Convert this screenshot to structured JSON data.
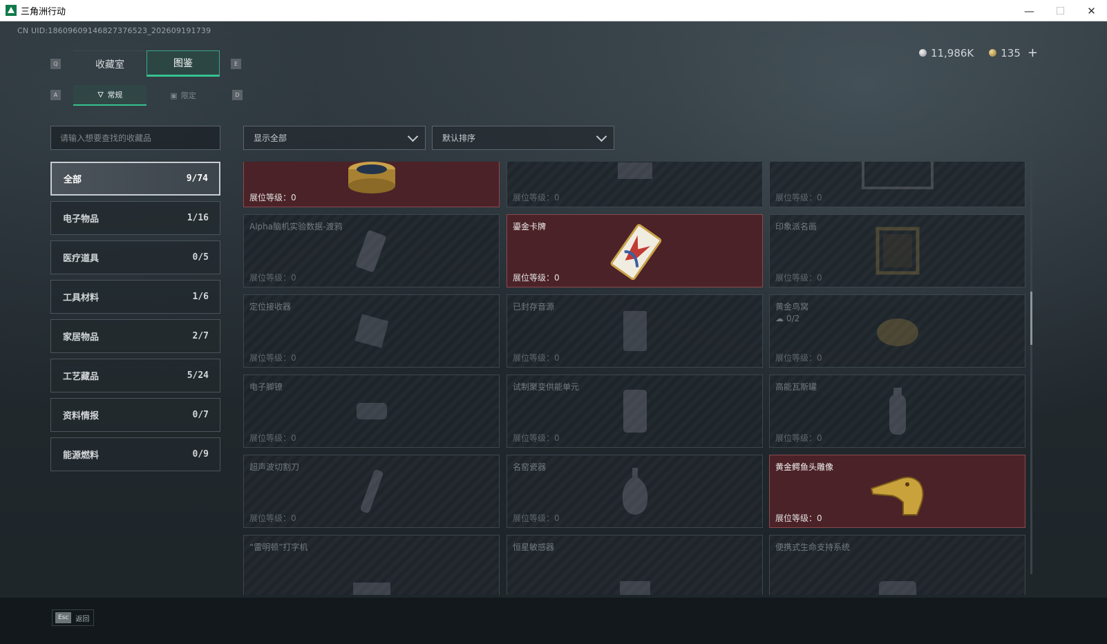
{
  "window": {
    "title": "三角洲行动",
    "minimize": "—",
    "maximize": "☐",
    "close": "✕"
  },
  "uid": "CN UID:18609609146827376523_202609191739",
  "currency": {
    "silver": "11,986K",
    "gold": "135",
    "add": "+"
  },
  "key_hints": {
    "prev_tab": "Q",
    "next_tab": "E",
    "prev_sub": "A",
    "next_sub": "D",
    "esc": "Esc"
  },
  "tabs": [
    {
      "label": "收藏室",
      "active": false
    },
    {
      "label": "图鉴",
      "active": true
    }
  ],
  "subtabs": [
    {
      "label": "常规",
      "icon": "bottle-icon",
      "active": true
    },
    {
      "label": "限定",
      "icon": "image-icon",
      "active": false
    }
  ],
  "search": {
    "placeholder": "请输入想要查找的收藏品"
  },
  "filters": {
    "display": "显示全部",
    "sort": "默认排序"
  },
  "categories": [
    {
      "label": "全部",
      "count": "9/74",
      "active": true
    },
    {
      "label": "电子物品",
      "count": "1/16"
    },
    {
      "label": "医疗道具",
      "count": "0/5"
    },
    {
      "label": "工具材料",
      "count": "1/6"
    },
    {
      "label": "家居物品",
      "count": "2/7"
    },
    {
      "label": "工艺藏品",
      "count": "5/24"
    },
    {
      "label": "资料情报",
      "count": "0/7"
    },
    {
      "label": "能源燃料",
      "count": "0/9"
    }
  ],
  "level_label": "展位等级：",
  "cards": [
    {
      "name": "",
      "level": "0",
      "owned": true,
      "icon": "caviar-tin-icon"
    },
    {
      "name": "",
      "level": "0",
      "owned": false,
      "icon": "device-icon"
    },
    {
      "name": "",
      "level": "0",
      "owned": false,
      "icon": "frame-icon"
    },
    {
      "name": "Alpha脑机实验数据-渡鸦",
      "level": "0",
      "owned": false,
      "icon": "data-drive-icon"
    },
    {
      "name": "鎏金卡牌",
      "level": "0",
      "owned": true,
      "icon": "gilded-card-icon"
    },
    {
      "name": "印象派名画",
      "level": "0",
      "owned": false,
      "icon": "painting-icon"
    },
    {
      "name": "定位接收器",
      "level": "0",
      "owned": false,
      "icon": "receiver-icon"
    },
    {
      "name": "已封存音源",
      "level": "0",
      "owned": false,
      "icon": "sealed-audio-icon"
    },
    {
      "name": "黄金鸟窝",
      "sub": "0/2",
      "level": "0",
      "owned": false,
      "icon": "golden-nest-icon"
    },
    {
      "name": "电子脚镣",
      "level": "0",
      "owned": false,
      "icon": "ankle-monitor-icon"
    },
    {
      "name": "试制聚变供能单元",
      "level": "0",
      "owned": false,
      "icon": "fusion-cell-icon"
    },
    {
      "name": "高能瓦斯罐",
      "level": "0",
      "owned": false,
      "icon": "gas-canister-icon"
    },
    {
      "name": "超声波切割刀",
      "level": "0",
      "owned": false,
      "icon": "ultrasonic-knife-icon"
    },
    {
      "name": "名窑瓷器",
      "level": "0",
      "owned": false,
      "icon": "porcelain-vase-icon"
    },
    {
      "name": "黄金鳄鱼头雕像",
      "level": "0",
      "owned": true,
      "icon": "golden-crocodile-icon"
    },
    {
      "name": "“雷明顿”打字机",
      "level": "",
      "owned": false,
      "icon": "typewriter-icon"
    },
    {
      "name": "恒星敏感器",
      "level": "",
      "owned": false,
      "icon": "star-sensor-icon"
    },
    {
      "name": "便携式生命支持系统",
      "level": "",
      "owned": false,
      "icon": "life-support-icon"
    }
  ],
  "footer": {
    "back_label": "返回"
  }
}
